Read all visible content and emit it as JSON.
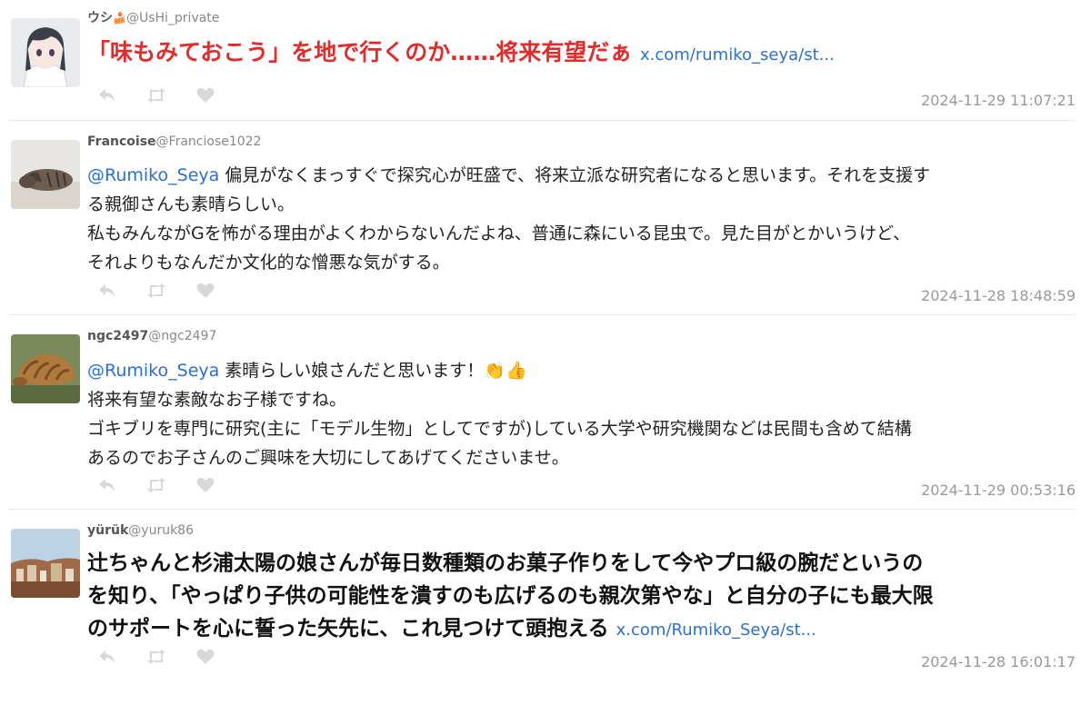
{
  "tweets": [
    {
      "name": "ウシ",
      "name_emoji": "🍰",
      "handle": "@UsHi_private",
      "text": "「味もみておこう」を地で行くのか……将来有望だぁ",
      "link": "x.com/rumiko_seya/st...",
      "timestamp": "2024-11-29 11:07:21"
    },
    {
      "name": "Francoise",
      "handle": "@Franciose1022",
      "mention": "@Rumiko_Seya",
      "lines": [
        " 偏見がなくまっすぐで探究心が旺盛で、将来立派な研究者になると思います。それを支援す",
        "る親御さんも素晴らしい。",
        "私もみんながGを怖がる理由がよくわからないんだよね、普通に森にいる昆虫で。見た目がとかいうけど、",
        "それよりもなんだか文化的な憎悪な気がする。"
      ],
      "timestamp": "2024-11-28 18:48:59"
    },
    {
      "name": "ngc2497",
      "handle": "@ngc2497",
      "mention": "@Rumiko_Seya",
      "first_line_text": " 素晴らしい娘さんだと思います！",
      "emoji_1": "👏",
      "emoji_2": "👍",
      "lines": [
        "将来有望な素敵なお子様ですね。",
        "ゴキブリを専門に研究(主に「モデル生物」としてですが)している大学や研究機関などは民間も含めて結構",
        "あるのでお子さんのご興味を大切にしてあげてくださいませ。"
      ],
      "timestamp": "2024-11-29 00:53:16"
    },
    {
      "name": "yürük",
      "handle": "@yuruk86",
      "lines": [
        "辻ちゃんと杉浦太陽の娘さんが毎日数種類のお菓子作りをして今やプロ級の腕だというの",
        "を知り、「やっぱり子供の可能性を潰すのも広げるのも親次第やな」と自分の子にも最大限",
        "のサポートを心に誓った矢先に、これ見つけて頭抱える"
      ],
      "link": "x.com/Rumiko_Seya/st...",
      "timestamp": "2024-11-28 16:01:17"
    }
  ],
  "icons": {
    "reply": "reply-icon",
    "retweet": "retweet-icon",
    "like": "heart-icon"
  },
  "colors": {
    "link": "#2b6fd6",
    "highlight_red": "#e32b2b",
    "icon_gray": "#d8d8d8",
    "timestamp": "#999999"
  }
}
